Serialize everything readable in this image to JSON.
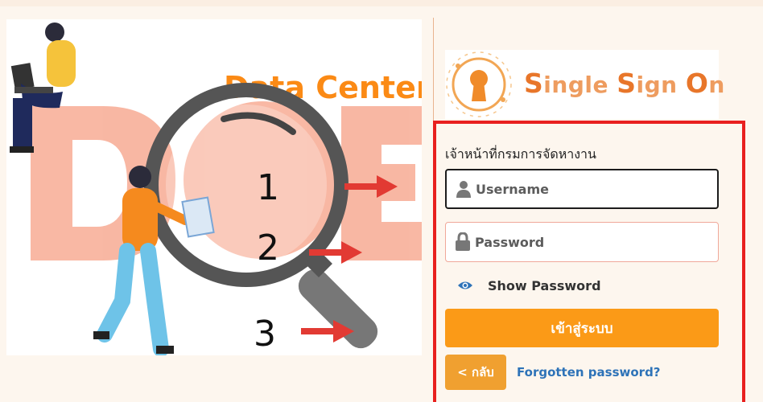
{
  "illustration": {
    "banner_text": "Data Center",
    "numbers": [
      "1",
      "2",
      "3"
    ]
  },
  "logo": {
    "title_parts": [
      "S",
      "ingle ",
      "S",
      "ign ",
      "O",
      "n"
    ]
  },
  "login": {
    "department_label": "เจ้าหน้าที่กรมการจัดหางาน",
    "username_placeholder": "Username",
    "password_placeholder": "Password",
    "show_password_label": "Show Password",
    "login_button": "เข้าสู่ระบบ",
    "back_button": "< กลับ",
    "forgot_link": "Forgotten password?"
  },
  "colors": {
    "accent_orange": "#fb9a17",
    "highlight_red": "#e8201f",
    "link_blue": "#2e73b8",
    "logo_orange": "#ee8d3d"
  },
  "icons": {
    "username_icon": "user-icon",
    "password_icon": "lock-icon",
    "show_password_icon": "eye-icon"
  }
}
